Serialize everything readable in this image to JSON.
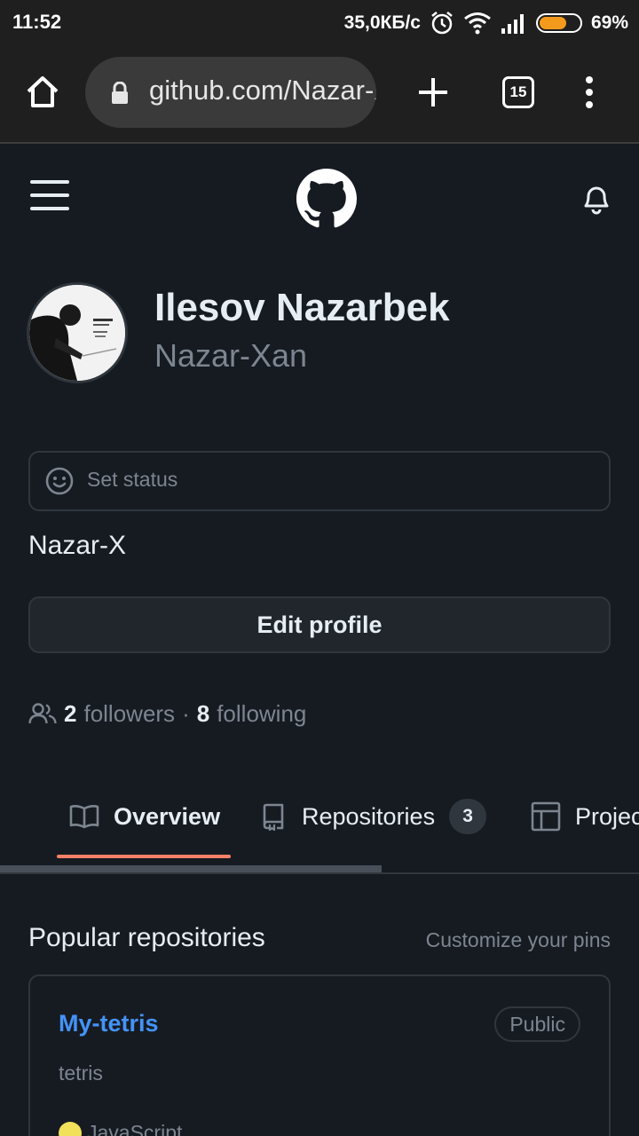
{
  "status_bar": {
    "time": "11:52",
    "network_speed": "35,0КБ/с",
    "battery_percent": "69%",
    "battery_level": 0.69,
    "icons": [
      "alarm-icon",
      "wifi-icon",
      "signal-icon",
      "battery-icon"
    ]
  },
  "browser": {
    "url": "github.com/Nazar-Xan",
    "tab_count": "15",
    "icons": [
      "home-icon",
      "lock-icon",
      "plus-icon",
      "tabs-icon",
      "more-vert-icon"
    ]
  },
  "header": {
    "icons": [
      "hamburger-menu-icon",
      "github-logo-icon",
      "notification-bell-icon"
    ]
  },
  "profile": {
    "name": "Ilesov Nazarbek",
    "login": "Nazar-Xan",
    "status_placeholder": "Set status",
    "bio": "Nazar-X",
    "edit_label": "Edit profile",
    "followers_count": "2",
    "followers_label": "followers",
    "separator": "·",
    "following_count": "8",
    "following_label": "following"
  },
  "tabs": [
    {
      "label": "Overview",
      "icon": "book-icon",
      "selected": true
    },
    {
      "label": "Repositories",
      "icon": "repo-icon",
      "counter": "3"
    },
    {
      "label": "Projects",
      "icon": "table-icon"
    }
  ],
  "popular": {
    "title": "Popular repositories",
    "customize_label": "Customize your pins",
    "repos": [
      {
        "name": "My-tetris",
        "visibility": "Public",
        "description": "tetris",
        "language": "JavaScript",
        "language_color": "#f1e05a"
      }
    ]
  },
  "colors": {
    "background": "#161b22",
    "border": "#30363d",
    "link": "#4493f8",
    "muted": "#7d8590",
    "accent_underline": "#f78166"
  }
}
